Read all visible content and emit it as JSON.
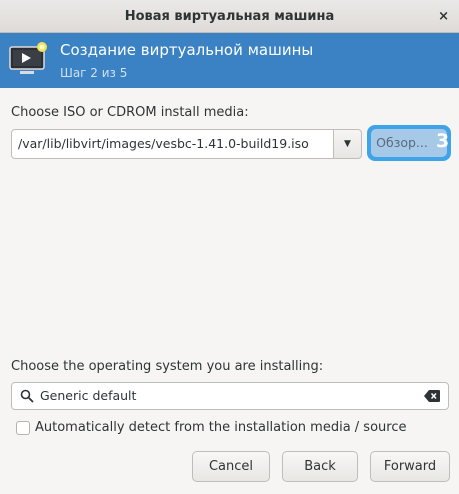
{
  "window": {
    "title": "Новая виртуальная машина",
    "close_glyph": "×"
  },
  "banner": {
    "title": "Создание виртуальной машины",
    "step": "Шаг 2 из 5",
    "icon": "monitor-icon",
    "bg_color": "#3b82c4"
  },
  "media": {
    "label": "Choose ISO or CDROM install media:",
    "path": "/var/lib/libvirt/images/vesbc-1.41.0-build19.iso",
    "dropdown_glyph": "▼",
    "browse_label": "Обзор...",
    "badge": "3"
  },
  "os": {
    "label": "Choose the operating system you are installing:",
    "search_value": "Generic default",
    "search_icon": "search-icon",
    "clear_icon": "clear-icon",
    "auto_detect_label": "Automatically detect from the installation media / source",
    "auto_detect_checked": false
  },
  "buttons": {
    "cancel": "Cancel",
    "back": "Back",
    "forward": "Forward"
  }
}
